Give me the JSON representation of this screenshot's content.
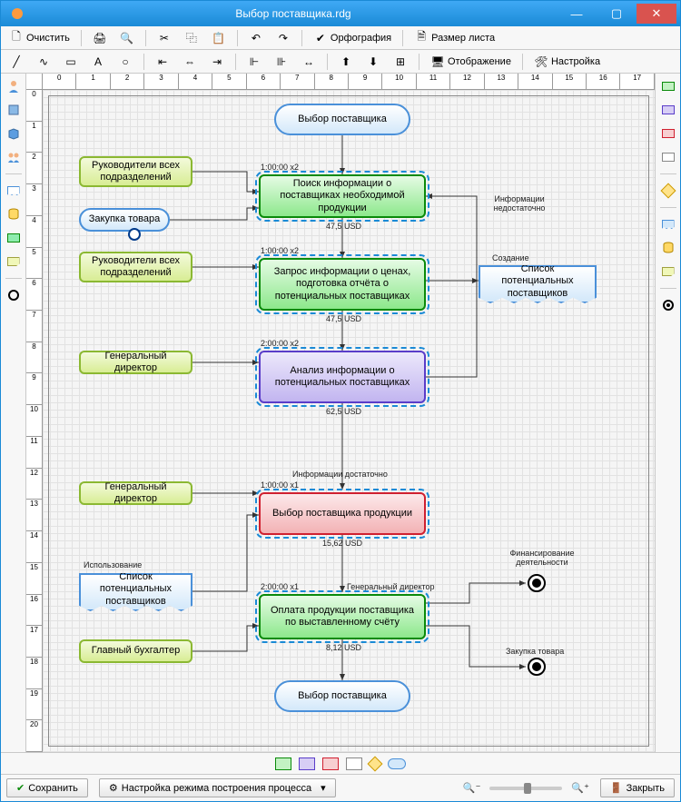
{
  "window": {
    "title": "Выбор поставщика.rdg"
  },
  "toolbar1": {
    "clear": "Очистить",
    "spelling": "Орфография",
    "pagesize": "Размер листа"
  },
  "toolbar2": {
    "display": "Отображение",
    "settings": "Настройка"
  },
  "ruler_h": [
    "0",
    "1",
    "2",
    "3",
    "4",
    "5",
    "6",
    "7",
    "8",
    "9",
    "10",
    "11",
    "12",
    "13",
    "14",
    "15",
    "16",
    "17"
  ],
  "ruler_v": [
    "0",
    "1",
    "2",
    "3",
    "4",
    "5",
    "6",
    "7",
    "8",
    "9",
    "10",
    "11",
    "12",
    "13",
    "14",
    "15",
    "16",
    "17",
    "18",
    "19",
    "20"
  ],
  "nodes": {
    "start": "Выбор поставщика",
    "role1": "Руководители всех подразделений",
    "input1": "Закупка товара",
    "step1": "Поиск информации о поставщиках необходимой продукции",
    "role2": "Руководители всех подразделений",
    "step2": "Запрос информации о ценах, подготовка отчёта о потенциальных поставщиках",
    "doc1": "Список потенциальных поставщиков",
    "role3": "Генеральный директор",
    "step3": "Анализ информации о потенциальных поставщиках",
    "role4": "Генеральный директор",
    "step4": "Выбор поставщика продукции",
    "doc2": "Список потенциальных поставщиков",
    "role5": "Главный бухгалтер",
    "step5": "Оплата продукции поставщика по выставленному счёту",
    "end": "Выбор поставщика"
  },
  "labels": {
    "t1": "1:00:00 x2",
    "c1": "47,5 USD",
    "t2": "1:00:00 x2",
    "c2": "47,5 USD",
    "create": "Создание",
    "t3": "2:00:00 x2",
    "c3": "62,5 USD",
    "notEnough": "Информации недостаточно",
    "enough": "Информации достаточно",
    "t4": "1:00:00 x1",
    "c4": "15,62 USD",
    "use": "Использование",
    "t5": "2:00:00 x1",
    "gendir": "Генеральный директор",
    "c5": "8,12 USD",
    "fin": "Финансирование деятельности",
    "buy": "Закупка товара"
  },
  "bottom": {
    "save": "Сохранить",
    "mode": "Настройка режима построения процесса",
    "close": "Закрыть"
  }
}
